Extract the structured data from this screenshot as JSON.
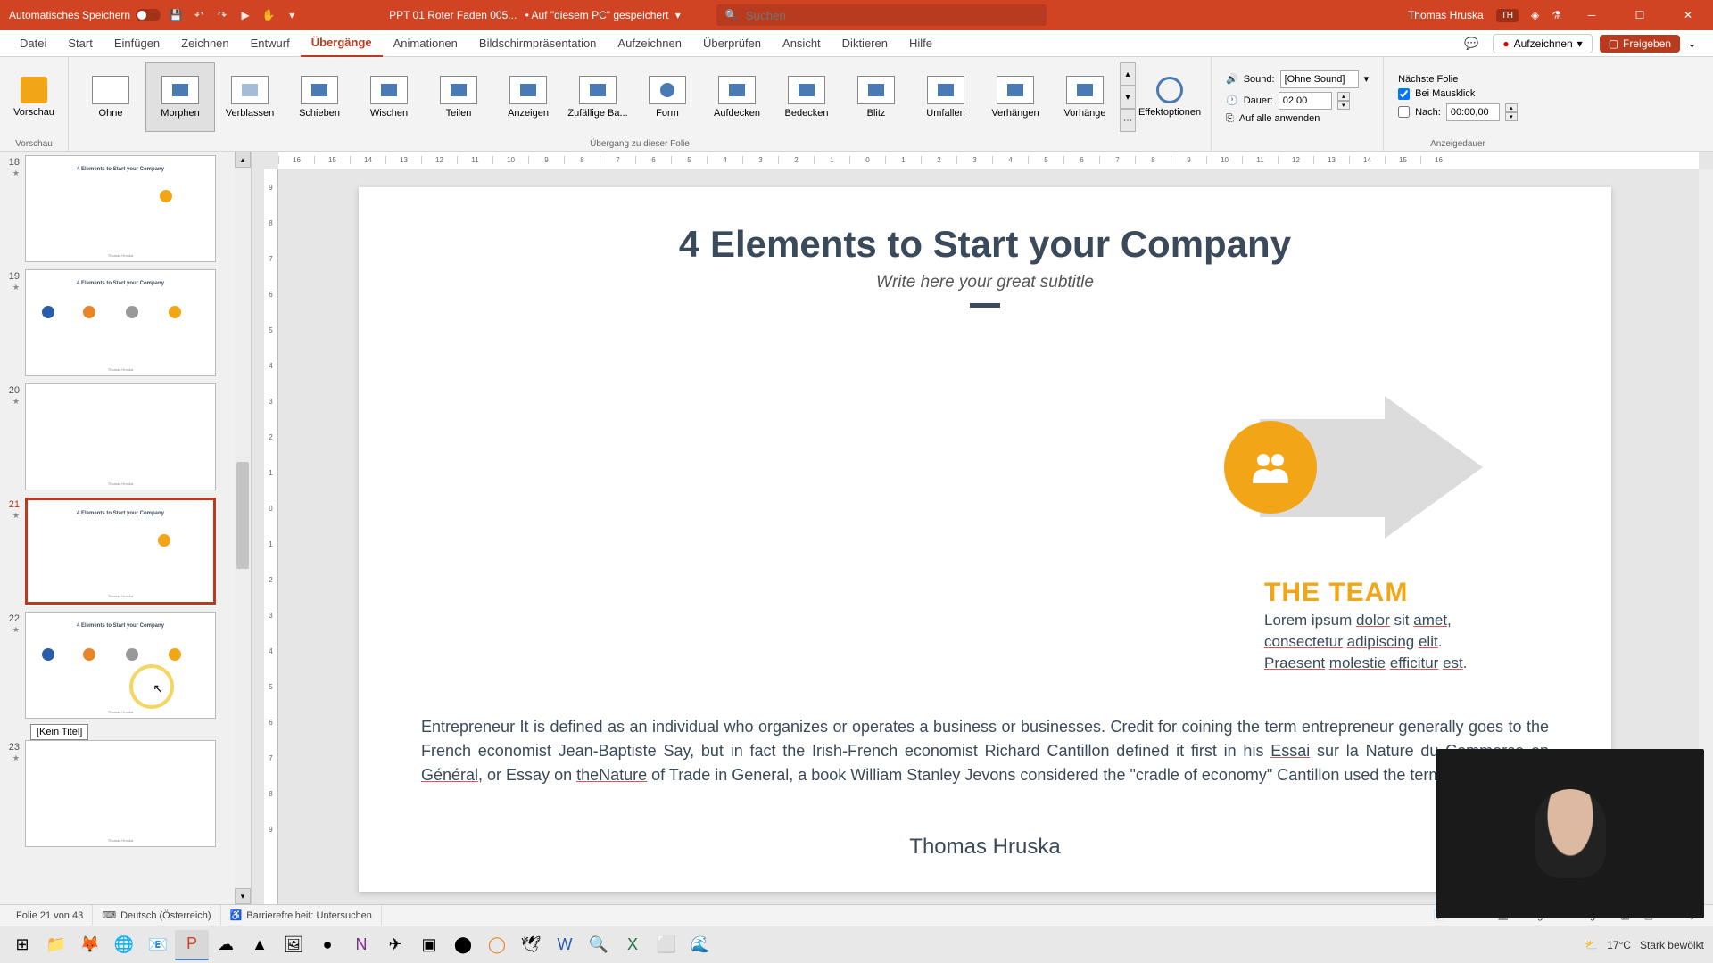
{
  "titlebar": {
    "autosave": "Automatisches Speichern",
    "filename": "PPT 01 Roter Faden 005...",
    "save_loc": "• Auf \"diesem PC\" gespeichert",
    "search_placeholder": "Suchen",
    "user": "Thomas Hruska",
    "user_initials": "TH"
  },
  "tabs": {
    "datei": "Datei",
    "start": "Start",
    "einfuegen": "Einfügen",
    "zeichnen": "Zeichnen",
    "entwurf": "Entwurf",
    "uebergaenge": "Übergänge",
    "animationen": "Animationen",
    "bildschirm": "Bildschirmpräsentation",
    "aufzeichnen_tab": "Aufzeichnen",
    "ueberpruefen": "Überprüfen",
    "ansicht": "Ansicht",
    "diktieren": "Diktieren",
    "hilfe": "Hilfe",
    "aufzeichnen_btn": "Aufzeichnen",
    "freigeben": "Freigeben"
  },
  "ribbon": {
    "vorschau": "Vorschau",
    "transitions": {
      "ohne": "Ohne",
      "morphen": "Morphen",
      "verblassen": "Verblassen",
      "schieben": "Schieben",
      "wischen": "Wischen",
      "teilen": "Teilen",
      "anzeigen": "Anzeigen",
      "zufaellig": "Zufällige Ba...",
      "form": "Form",
      "aufdecken": "Aufdecken",
      "bedecken": "Bedecken",
      "blitz": "Blitz",
      "umfallen": "Umfallen",
      "verhaengen": "Verhängen",
      "vorhaenge": "Vorhänge"
    },
    "effektoptionen": "Effektoptionen",
    "group_trans": "Übergang zu dieser Folie",
    "sound_label": "Sound:",
    "sound_value": "[Ohne Sound]",
    "dauer_label": "Dauer:",
    "dauer_value": "02,00",
    "apply_all": "Auf alle anwenden",
    "next_slide": "Nächste Folie",
    "bei_mausklick": "Bei Mausklick",
    "nach": "Nach:",
    "nach_value": "00:00,00",
    "group_timing": "Anzeigedauer"
  },
  "thumbs": {
    "n18": "18",
    "n19": "19",
    "n20": "20",
    "n21": "21",
    "n22": "22",
    "n23": "23",
    "mini_title": "4 Elements to Start your Company",
    "mini_footer": "Thomas Hruska",
    "tooltip": "[Kein Titel]"
  },
  "slide": {
    "title": "4 Elements to Start your Company",
    "subtitle": "Write here your great subtitle",
    "team_heading": "THE TEAM",
    "team_l1a": "Lorem ipsum ",
    "team_l1b": "dolor",
    "team_l1c": " sit ",
    "team_l1d": "amet",
    "team_l1e": ",",
    "team_l2a": "consectetur",
    "team_l2b": " ",
    "team_l2c": "adipiscing",
    "team_l2d": " ",
    "team_l2e": "elit",
    "team_l2f": ".",
    "team_l3a": "Praesent",
    "team_l3b": " ",
    "team_l3c": "molestie",
    "team_l3d": " ",
    "team_l3e": "efficitur",
    "team_l3f": " ",
    "team_l3g": "est",
    "team_l3h": ".",
    "para1": "Entrepreneur  It is defined as an individual who organizes or operates a business or businesses. Credit for coining the term entrepreneur generally goes to the French economist Jean-Baptiste Say, but in fact the Irish-French economist Richard Cantillon defined it first in his ",
    "para_essai": "Essai",
    "para2": " sur la Nature du Commerce ",
    "para_en": "en",
    "para_sp1": " ",
    "para_general": "Général",
    "para3": ", or Essay on ",
    "para_nature": "theNature",
    "para4": " of Trade in General, a book William Stanley Jevons considered the \"cradle of economy\" Cantillon used the term differently.",
    "author": "Thomas Hruska"
  },
  "status": {
    "slide_count": "Folie 21 von 43",
    "lang": "Deutsch (Österreich)",
    "access": "Barrierefreiheit: Untersuchen",
    "notes": "Notizen",
    "display": "Anzeigeeinstellungen"
  },
  "taskbar": {
    "weather_temp": "17°C",
    "weather_desc": "Stark bewölkt"
  }
}
